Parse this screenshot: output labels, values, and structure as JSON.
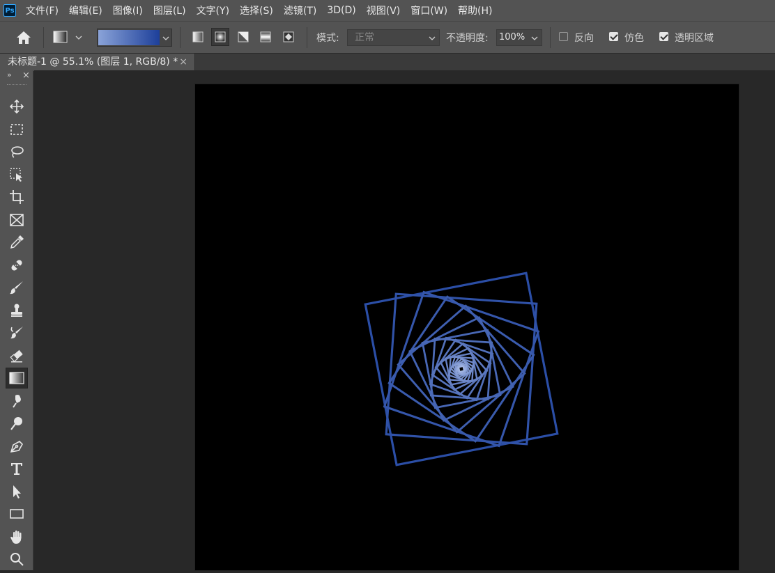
{
  "app": {
    "logo_text": "Ps"
  },
  "menu": [
    "文件(F)",
    "编辑(E)",
    "图像(I)",
    "图层(L)",
    "文字(Y)",
    "选择(S)",
    "滤镜(T)",
    "3D(D)",
    "视图(V)",
    "窗口(W)",
    "帮助(H)"
  ],
  "options": {
    "gradient_colors": [
      "#8aa3d8",
      "#1d3f9a"
    ],
    "mode_label": "模式:",
    "mode_value": "正常",
    "opacity_label": "不透明度:",
    "opacity_value": "100%",
    "reverse_label": "反向",
    "reverse_checked": false,
    "dither_label": "仿色",
    "dither_checked": true,
    "transparency_label": "透明区域",
    "transparency_checked": true,
    "gradient_modes": [
      "linear-gradient-icon",
      "radial-gradient-icon",
      "angle-gradient-icon",
      "reflected-gradient-icon",
      "diamond-gradient-icon"
    ],
    "active_mode": "radial-gradient-icon"
  },
  "document": {
    "tab_title": "未标题-1 @ 55.1% (图层 1, RGB/8) *",
    "close_glyph": "×"
  },
  "toolbar": {
    "collapse_glyph": "»",
    "close_glyph": "×",
    "tools": [
      "move-tool-icon",
      "marquee-tool-icon",
      "lasso-tool-icon",
      "object-select-tool-icon",
      "crop-tool-icon",
      "frame-tool-icon",
      "eyedropper-tool-icon",
      "healing-brush-icon",
      "brush-tool-icon",
      "clone-stamp-icon",
      "history-brush-icon",
      "eraser-tool-icon",
      "gradient-tool-icon",
      "smudge-tool-icon",
      "dodge-tool-icon",
      "pen-tool-icon",
      "type-tool-icon",
      "path-select-icon",
      "rectangle-tool-icon",
      "hand-tool-icon",
      "zoom-tool-icon"
    ],
    "active_tool": "gradient-tool-icon"
  },
  "artwork": {
    "stroke_outer": "#2b4ea6",
    "stroke_inner": "#b9c9ee"
  }
}
